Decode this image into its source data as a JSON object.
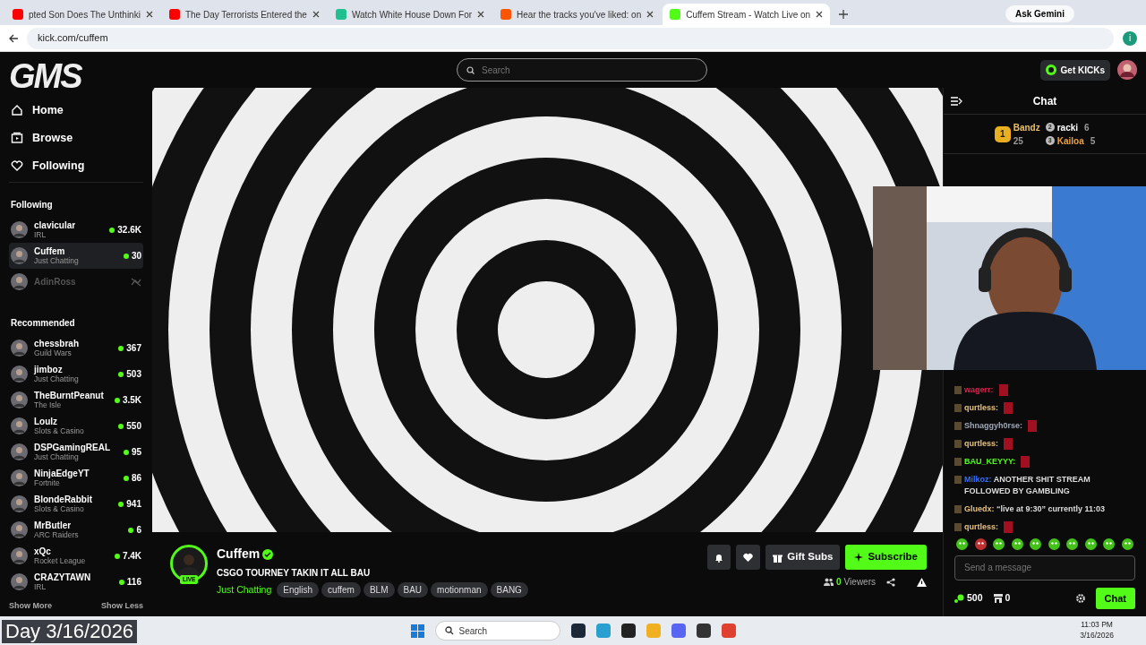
{
  "browser": {
    "tabs": [
      {
        "title": "pted Son Does The Unthinki",
        "color": "#ff0000",
        "selected": false
      },
      {
        "title": "The Day Terrorists Entered the",
        "color": "#ff0000",
        "selected": false
      },
      {
        "title": "Watch White House Down For",
        "color": "#1fbf8f",
        "selected": false
      },
      {
        "title": "Hear the tracks you've liked: on",
        "color": "#ff5500",
        "selected": false
      },
      {
        "title": "Cuffem Stream - Watch Live on",
        "color": "#53fc18",
        "selected": true
      }
    ],
    "ask_gemini": "Ask Gemini",
    "address": "kick.com/cuffem",
    "profile_initial": "i"
  },
  "site": {
    "logo": "GMS",
    "search_placeholder": "Search",
    "get_kicks": "Get KICKs"
  },
  "sidebar": {
    "nav": [
      {
        "label": "Home",
        "kind": "home"
      },
      {
        "label": "Browse",
        "kind": "browse"
      },
      {
        "label": "Following",
        "kind": "following"
      }
    ],
    "following_title": "Following",
    "following": [
      {
        "name": "clavicular",
        "category": "IRL",
        "viewers": "32.6K",
        "live": true,
        "selected": false
      },
      {
        "name": "Cuffem",
        "category": "Just Chatting",
        "viewers": "30",
        "live": true,
        "selected": true
      },
      {
        "name": "AdinRoss",
        "live": false,
        "selected": false
      }
    ],
    "recommended_title": "Recommended",
    "recommended": [
      {
        "name": "chessbrah",
        "category": "Guild Wars",
        "viewers": "367",
        "live": true,
        "selected": false
      },
      {
        "name": "jimboz",
        "category": "Just Chatting",
        "viewers": "503",
        "live": true,
        "selected": false
      },
      {
        "name": "TheBurntPeanut",
        "category": "The Isle",
        "viewers": "3.5K",
        "live": true,
        "selected": false
      },
      {
        "name": "Loulz",
        "category": "Slots & Casino",
        "viewers": "550",
        "live": true,
        "selected": false
      },
      {
        "name": "DSPGamingREAL",
        "category": "Just Chatting",
        "viewers": "95",
        "live": true,
        "selected": false
      },
      {
        "name": "NinjaEdgeYT",
        "category": "Fortnite",
        "viewers": "86",
        "live": true,
        "selected": false
      },
      {
        "name": "BlondeRabbit",
        "category": "Slots & Casino",
        "viewers": "941",
        "live": true,
        "selected": false
      },
      {
        "name": "MrButler",
        "category": "ARC Raiders",
        "viewers": "6",
        "live": true,
        "selected": false
      },
      {
        "name": "xQc",
        "category": "Rocket League",
        "viewers": "7.4K",
        "live": true,
        "selected": false
      },
      {
        "name": "CRAZYTAWN",
        "category": "IRL",
        "viewers": "116",
        "live": true,
        "selected": false
      }
    ],
    "show_more": "Show More",
    "show_less": "Show Less"
  },
  "stream": {
    "channel": "Cuffem",
    "verified": true,
    "live_badge": "LIVE",
    "title": "CSGO TOURNEY TAKIN IT ALL BAU",
    "category": "Just Chatting",
    "tags": [
      "English",
      "cuffem",
      "BLM",
      "BAU",
      "motionman",
      "BANG"
    ],
    "gift_subs": "Gift Subs",
    "subscribe": "Subscribe",
    "viewer_count": "0",
    "viewers_label": "Viewers"
  },
  "chat": {
    "title": "Chat",
    "leaders": [
      {
        "rank": "1",
        "name": "Bandz",
        "count": "25",
        "color": "#f0c060"
      },
      {
        "rank": "2",
        "name": "racki",
        "count": "6",
        "color": "#ffffff"
      },
      {
        "rank": "3",
        "name": "Kailoa",
        "count": "5",
        "color": "#e8a040"
      }
    ],
    "messages": [
      {
        "user": "wagerr",
        "color": "#e0204a",
        "separator": ":"
      },
      {
        "user": "qurtless",
        "color": "#e8c080",
        "separator": ":"
      },
      {
        "user": "Shnaggyh0rse",
        "color": "#a0a8b8",
        "separator": ":"
      },
      {
        "user": "qurtless",
        "color": "#e8c080",
        "separator": ":"
      },
      {
        "user": "BAU_KEYYY",
        "color": "#53fc18",
        "separator": ":"
      },
      {
        "user": "Milkoz",
        "color": "#3070ff",
        "separator": ":",
        "text": "ANOTHER SHIT STREAM FOLLOWED BY GAMBLING"
      },
      {
        "user": "Gluedx",
        "color": "#e8c080",
        "separator": ":",
        "text": "“live at 9:30” currently 11:03"
      },
      {
        "user": "qurtless",
        "color": "#e8c080",
        "separator": ":"
      }
    ],
    "input_placeholder": "Send a message",
    "points": "500",
    "store_count": "0",
    "send": "Chat"
  },
  "overlay_caption": "Day 3/16/2026",
  "taskbar": {
    "search": "Search",
    "time": "11:03 PM",
    "date": "3/16/2026"
  }
}
